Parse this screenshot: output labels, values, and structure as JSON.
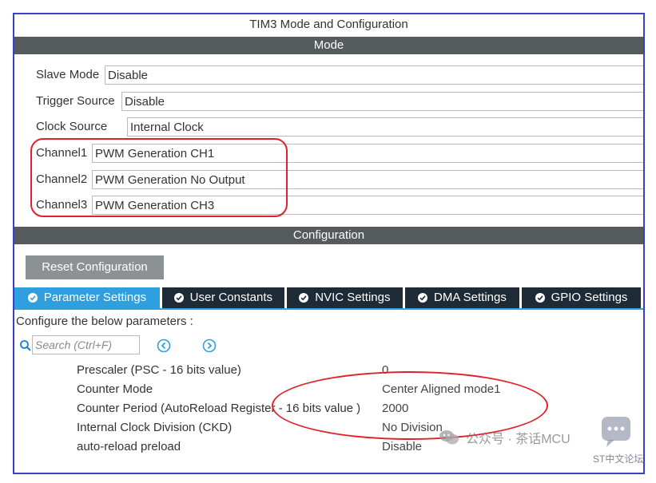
{
  "window": {
    "title": "TIM3 Mode and Configuration"
  },
  "mode": {
    "header": "Mode",
    "slave_mode": {
      "label": "Slave Mode",
      "value": "Disable"
    },
    "trigger_source": {
      "label": "Trigger Source",
      "value": "Disable"
    },
    "clock_source": {
      "label": "Clock Source",
      "value": "Internal Clock"
    },
    "channel1": {
      "label": "Channel1",
      "value": "PWM Generation CH1"
    },
    "channel2": {
      "label": "Channel2",
      "value": "PWM Generation No Output"
    },
    "channel3": {
      "label": "Channel3",
      "value": "PWM Generation CH3"
    }
  },
  "configuration": {
    "header": "Configuration",
    "reset_button": "Reset Configuration",
    "tabs": [
      {
        "label": "Parameter Settings",
        "active": true
      },
      {
        "label": "User Constants",
        "active": false
      },
      {
        "label": "NVIC Settings",
        "active": false
      },
      {
        "label": "DMA Settings",
        "active": false
      },
      {
        "label": "GPIO Settings",
        "active": false
      }
    ],
    "instruction": "Configure the below parameters :",
    "search": {
      "placeholder": "Search (Ctrl+F)",
      "value": ""
    },
    "parameters": [
      {
        "name": "Prescaler (PSC - 16 bits value)",
        "value": "0"
      },
      {
        "name": "Counter Mode",
        "value": "Center Aligned mode1"
      },
      {
        "name": "Counter Period (AutoReload Register - 16 bits value )",
        "value": "2000"
      },
      {
        "name": "Internal Clock Division (CKD)",
        "value": "No Division"
      },
      {
        "name": "auto-reload preload",
        "value": "Disable"
      }
    ]
  },
  "watermark": {
    "text": "公众号 · 茶话MCU",
    "small_text": "ST中文论坛"
  },
  "colors": {
    "frame_border": "#3b3fc4",
    "section_bar": "#555a5c",
    "active_tab": "#2f9fe0",
    "inactive_tab": "#1e2a35",
    "annotation_red": "#e0202c",
    "reset_button": "#8c9194"
  },
  "icons": {
    "tab_check": "check-circle-icon",
    "search": "search-icon",
    "prev": "arrow-left-circle-icon",
    "next": "arrow-right-circle-icon",
    "watermark": "wechat-icon"
  }
}
